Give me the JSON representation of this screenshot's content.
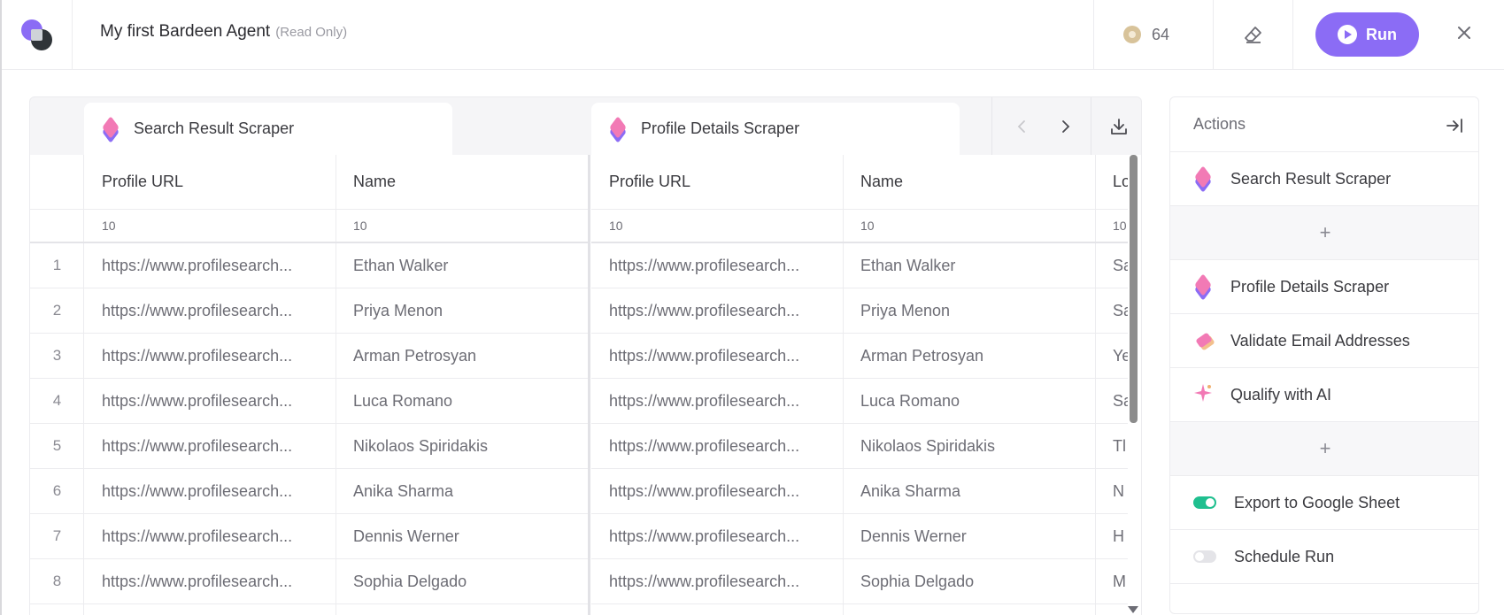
{
  "header": {
    "title": "My first Bardeen Agent",
    "readonly": "(Read Only)",
    "credits": "64",
    "run_label": "Run"
  },
  "tables": [
    {
      "name": "Search Result Scraper",
      "columns": [
        "Profile URL",
        "Name"
      ],
      "counts": [
        "10",
        "10"
      ]
    },
    {
      "name": "Profile Details Scraper",
      "columns": [
        "Profile URL",
        "Name",
        "Lo"
      ],
      "counts": [
        "10",
        "10",
        "10"
      ]
    }
  ],
  "rows": [
    {
      "idx": "1",
      "url": "https://www.profilesearch...",
      "name": "Ethan Walker",
      "loc": "Sa"
    },
    {
      "idx": "2",
      "url": "https://www.profilesearch...",
      "name": "Priya Menon",
      "loc": "Sa"
    },
    {
      "idx": "3",
      "url": "https://www.profilesearch...",
      "name": "Arman Petrosyan",
      "loc": "Ye"
    },
    {
      "idx": "4",
      "url": "https://www.profilesearch...",
      "name": "Luca Romano",
      "loc": "Sa"
    },
    {
      "idx": "5",
      "url": "https://www.profilesearch...",
      "name": "Nikolaos Spiridakis",
      "loc": "Tl"
    },
    {
      "idx": "6",
      "url": "https://www.profilesearch...",
      "name": "Anika Sharma",
      "loc": "N"
    },
    {
      "idx": "7",
      "url": "https://www.profilesearch...",
      "name": "Dennis Werner",
      "loc": "H"
    },
    {
      "idx": "8",
      "url": "https://www.profilesearch...",
      "name": "Sophia Delgado",
      "loc": "M"
    }
  ],
  "actions": {
    "title": "Actions",
    "items": [
      {
        "label": "Search Result Scraper",
        "icon": "stack-icon"
      },
      {
        "label": "+",
        "icon": "plus-icon"
      },
      {
        "label": "Profile Details Scraper",
        "icon": "stack-icon"
      },
      {
        "label": "Validate Email Addresses",
        "icon": "tag-icon"
      },
      {
        "label": "Qualify with AI",
        "icon": "sparkle-icon"
      },
      {
        "label": "+",
        "icon": "plus-icon"
      },
      {
        "label": "Export to Google Sheet",
        "icon": "toggle-on"
      },
      {
        "label": "Schedule Run",
        "icon": "toggle-off"
      }
    ]
  },
  "colors": {
    "accent": "#8b6cf5",
    "toggle_on": "#1fbf8f",
    "pink": "#f27ab5"
  }
}
